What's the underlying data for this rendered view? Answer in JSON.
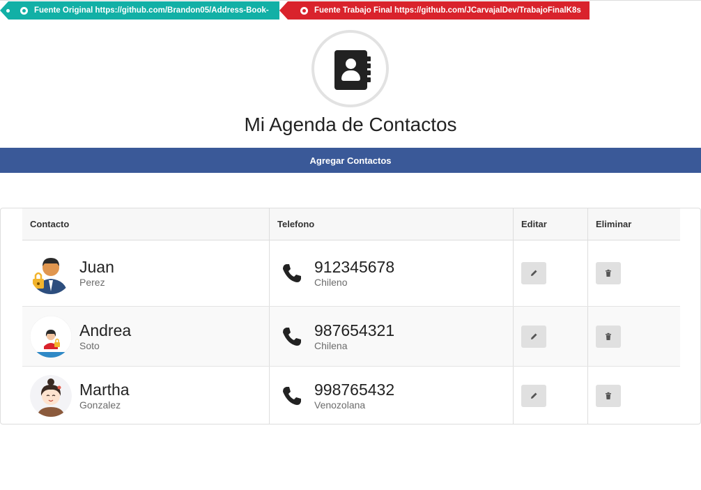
{
  "ribbons": {
    "original": {
      "label": "Fuente Original https://github.com/Brandon05/Address-Book-",
      "color": "#12b0a6"
    },
    "final": {
      "label": "Fuente Trabajo Final https://github.com/JCarvajalDev/TrabajoFinalK8s",
      "color": "#d9232c"
    }
  },
  "header": {
    "logo_icon": "address-book-icon",
    "title": "Mi Agenda de Contactos"
  },
  "nav": {
    "add_contacts": "Agregar Contactos",
    "color": "#3a5998"
  },
  "table": {
    "columns": [
      "Contacto",
      "Telefono",
      "Editar",
      "Eliminar"
    ],
    "rows": [
      {
        "first_name": "Juan",
        "last_name": "Perez",
        "phone": "912345678",
        "nationality": "Chileno",
        "avatar": "man-with-lock-avatar"
      },
      {
        "first_name": "Andrea",
        "last_name": "Soto",
        "phone": "987654321",
        "nationality": "Chilena",
        "avatar": "woman-with-lock-avatar"
      },
      {
        "first_name": "Martha",
        "last_name": "Gonzalez",
        "phone": "998765432",
        "nationality": "Venozolana",
        "avatar": "smiling-woman-avatar"
      }
    ],
    "edit_icon": "pencil-icon",
    "delete_icon": "trash-icon"
  }
}
